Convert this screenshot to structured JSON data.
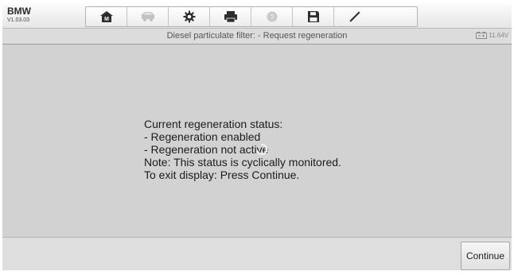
{
  "header": {
    "brand": "BMW",
    "version": "V1.03.03",
    "tools": [
      {
        "icon": "home-icon",
        "enabled": true
      },
      {
        "icon": "vehicle-swap-icon",
        "enabled": false
      },
      {
        "icon": "gear-icon",
        "enabled": true
      },
      {
        "icon": "printer-icon",
        "enabled": true
      },
      {
        "icon": "help-icon",
        "enabled": false
      },
      {
        "icon": "save-icon",
        "enabled": true
      },
      {
        "icon": "pen-icon",
        "enabled": true
      }
    ]
  },
  "titlebar": {
    "title": "Diesel particulate filter: - Request regeneration",
    "battery_voltage": "11.64V"
  },
  "message": {
    "lines": [
      "Current regeneration status:",
      "- Regeneration enabled",
      "- Regeneration not active",
      "Note: This status is cyclically monitored.",
      "To exit display: Press Continue."
    ]
  },
  "footer": {
    "continue_label": "Continue"
  },
  "colors": {
    "background": "#d2d2d2",
    "toolbar": "#f0f0f0",
    "icon": "#2e2e2e",
    "disabled_icon": "#c2c2c2"
  }
}
